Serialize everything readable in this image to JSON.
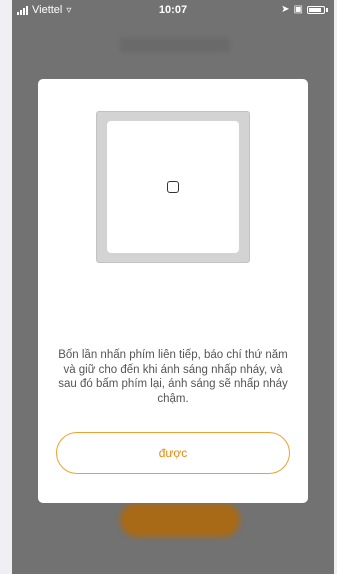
{
  "status_bar": {
    "carrier": "Viettel",
    "time": "10:07"
  },
  "dialog": {
    "instruction": "Bốn lần nhấn phím liên tiếp, báo chí thứ năm và giữ cho đến khi ánh sáng nhấp nháy, và sau đó bấm phím lại, ánh sáng sẽ nhấp nháy chậm.",
    "ok_label": "được"
  },
  "colors": {
    "accent": "#f0a030",
    "accent_text": "#e48a10",
    "overlay": "#727272"
  }
}
